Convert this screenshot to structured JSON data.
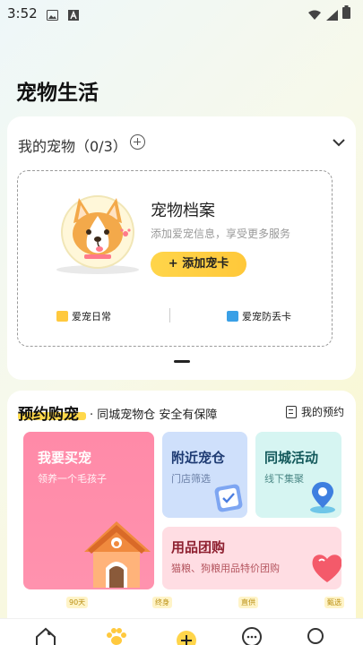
{
  "status_bar": {
    "time": "3:52",
    "icons": [
      "image-icon",
      "text-a-icon",
      "wifi-icon",
      "signal-icon",
      "battery-icon"
    ]
  },
  "page": {
    "title": "宠物生活"
  },
  "my_pets": {
    "header": "我的宠物（0/3）",
    "archive_title": "宠物档案",
    "archive_desc": "添加爱宠信息，享受更多服务",
    "add_button": "+ 添加宠卡",
    "features": [
      {
        "label": "爱宠日常",
        "icon": "daily-icon",
        "color": "#ffc93e"
      },
      {
        "label": "爱宠防丢卡",
        "icon": "card-icon",
        "color": "#3aa0e6"
      }
    ]
  },
  "appointment": {
    "title": "预约购宠",
    "subtitle": "· 同城宠物仓 安全有保障",
    "my_link": "我的预约",
    "tiles": {
      "buy": {
        "title": "我要买宠",
        "sub": "领养一个毛孩子"
      },
      "nearby": {
        "title": "附近宠仓",
        "sub": "门店筛选"
      },
      "city": {
        "title": "同城活动",
        "sub": "线下集聚"
      },
      "group": {
        "title": "用品团购",
        "sub": "猫粮、狗粮用品特价团购"
      }
    },
    "tags": [
      "90天",
      "终身",
      "直供",
      "甄选"
    ]
  },
  "tabbar": {
    "icons": [
      "home-pet-icon",
      "paw-icon",
      "add-icon",
      "message-icon",
      "profile-icon"
    ]
  },
  "colors": {
    "accent_yellow": "#ffd54a",
    "buy_pink": "#ff8aa8",
    "nearby_blue": "#cfe0fb",
    "city_teal": "#d6f5f2",
    "group_pink": "#ffdde3"
  }
}
